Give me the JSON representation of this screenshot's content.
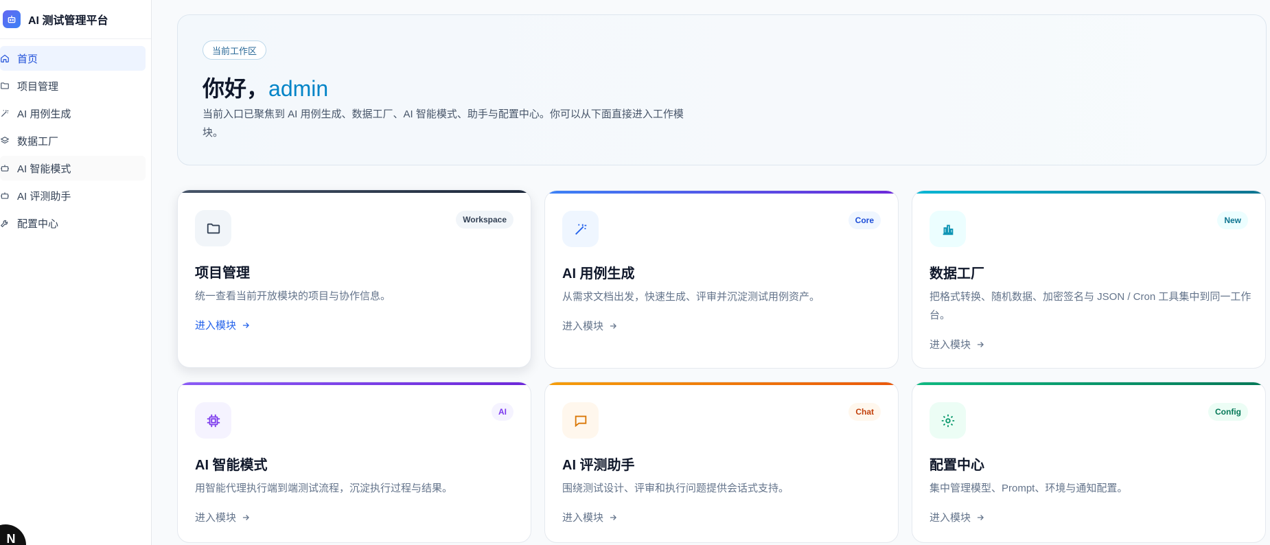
{
  "app": {
    "title": "AI 测试管理平台",
    "logo_icon": "robot-icon"
  },
  "sidebar": {
    "items": [
      {
        "label": "首页",
        "icon": "home-icon",
        "active": true
      },
      {
        "label": "项目管理",
        "icon": "folder-icon"
      },
      {
        "label": "AI 用例生成",
        "icon": "magic-wand-icon"
      },
      {
        "label": "数据工厂",
        "icon": "layers-icon"
      },
      {
        "label": "AI 智能模式",
        "icon": "bot-icon"
      },
      {
        "label": "AI 评测助手",
        "icon": "bot-icon"
      },
      {
        "label": "配置中心",
        "icon": "wrench-icon"
      }
    ],
    "badge_letter": "N"
  },
  "hero": {
    "chip": "当前工作区",
    "greeting": "你好，",
    "username": "admin",
    "description": "当前入口已聚焦到 AI 用例生成、数据工厂、AI 智能模式、助手与配置中心。你可以从下面直接进入工作模块。"
  },
  "cards": [
    {
      "title": "项目管理",
      "tag": "Workspace",
      "icon": "folder-icon",
      "description": "统一查看当前开放模块的项目与协作信息。",
      "link": "进入模块",
      "accent": "#475569"
    },
    {
      "title": "AI 用例生成",
      "tag": "Core",
      "icon": "magic-wand-icon",
      "description": "从需求文档出发，快速生成、评审并沉淀测试用例资产。",
      "link": "进入模块",
      "accent": "#4f46e5"
    },
    {
      "title": "数据工厂",
      "tag": "New",
      "icon": "bar-chart-icon",
      "description": "把格式转换、随机数据、加密签名与 JSON / Cron 工具集中到同一工作台。",
      "link": "进入模块",
      "accent": "#0891b2"
    },
    {
      "title": "AI 智能模式",
      "tag": "AI",
      "icon": "cpu-chip-icon",
      "description": "用智能代理执行端到端测试流程，沉淀执行过程与结果。",
      "link": "进入模块",
      "accent": "#7c3aed"
    },
    {
      "title": "AI 评测助手",
      "tag": "Chat",
      "icon": "chat-bubble-icon",
      "description": "围绕测试设计、评审和执行问题提供会话式支持。",
      "link": "进入模块",
      "accent": "#ea580c"
    },
    {
      "title": "配置中心",
      "tag": "Config",
      "icon": "gear-icon",
      "description": "集中管理模型、Prompt、环境与通知配置。",
      "link": "进入模块",
      "accent": "#059669"
    }
  ]
}
